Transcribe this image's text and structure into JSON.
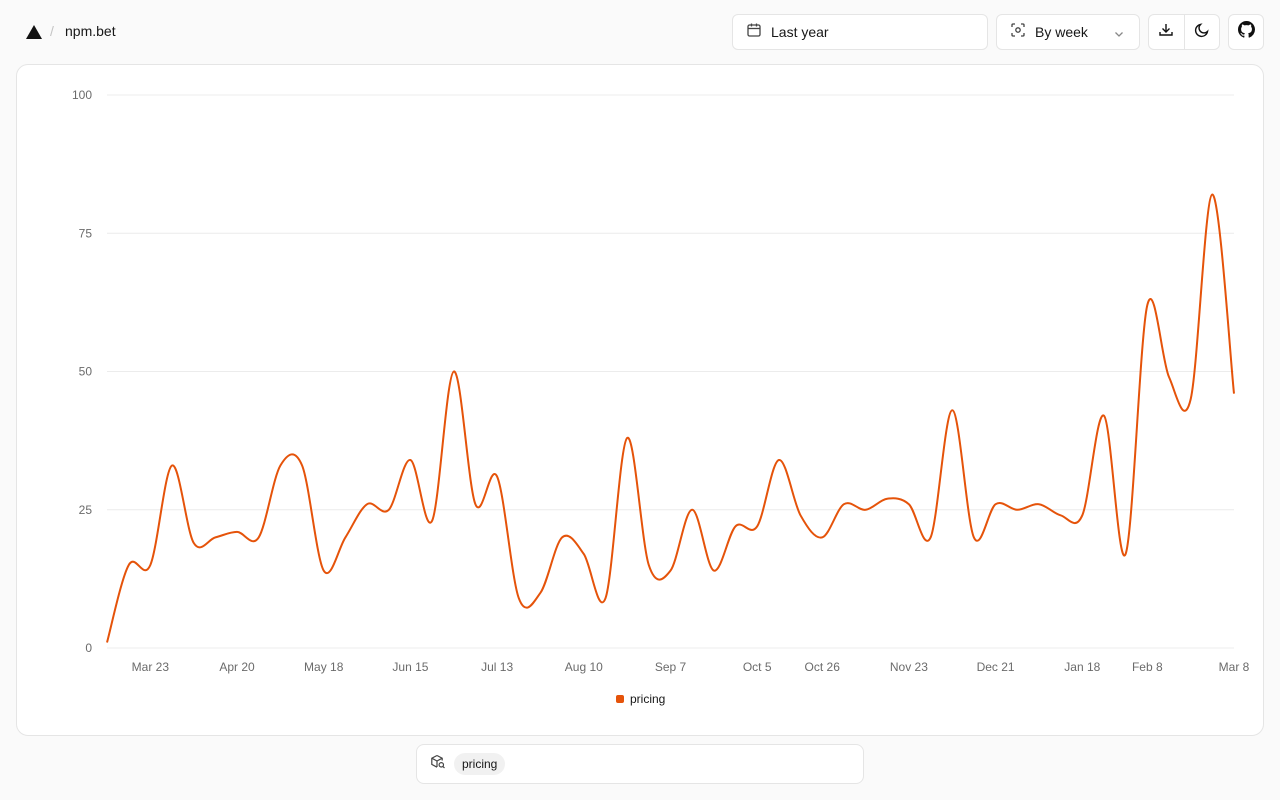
{
  "header": {
    "separator": "/",
    "site_name": "npm.bet",
    "range_label": "Last year",
    "interval_label": "By week"
  },
  "icons": {
    "logo": "triangle-logo-icon",
    "range": "calendar-icon",
    "interval": "scan-icon",
    "dropdown": "chevron-down-icon",
    "download": "download-icon",
    "theme": "moon-icon",
    "repo": "github-icon",
    "package": "package-search-icon"
  },
  "colors": {
    "accent": "#e5530a",
    "grid": "#ececec",
    "border": "#e5e5e5",
    "background": "#fafafa"
  },
  "chart_data": {
    "type": "line",
    "title": "",
    "xlabel": "",
    "ylabel": "",
    "ylim": [
      0,
      100
    ],
    "yticks": [
      "0",
      "25",
      "50",
      "75",
      "100"
    ],
    "grid": true,
    "legend_placement": "bottom-center",
    "x_tick_labels": [
      "Mar 23",
      "Apr 20",
      "May 18",
      "Jun 15",
      "Jul 13",
      "Aug 10",
      "Sep 7",
      "Oct 5",
      "Oct 26",
      "Nov 23",
      "Dec 21",
      "Jan 18",
      "Feb 8",
      "Mar 8"
    ],
    "x_tick_weeks": [
      2,
      6,
      10,
      14,
      18,
      22,
      26,
      30,
      33,
      37,
      41,
      45,
      48,
      52
    ],
    "series": [
      {
        "name": "pricing",
        "color": "#e5530a",
        "values": [
          1,
          15,
          15,
          33,
          19,
          20,
          21,
          20,
          33,
          33,
          14,
          20,
          26,
          25,
          34,
          23,
          50,
          26,
          31,
          9,
          10,
          20,
          17,
          9,
          38,
          15,
          14,
          25,
          14,
          22,
          22,
          34,
          24,
          20,
          26,
          25,
          27,
          26,
          20,
          43,
          20,
          26,
          25,
          26,
          24,
          24,
          42,
          17,
          62,
          49,
          45,
          82,
          46
        ]
      }
    ]
  },
  "search": {
    "chips": [
      "pricing"
    ]
  }
}
